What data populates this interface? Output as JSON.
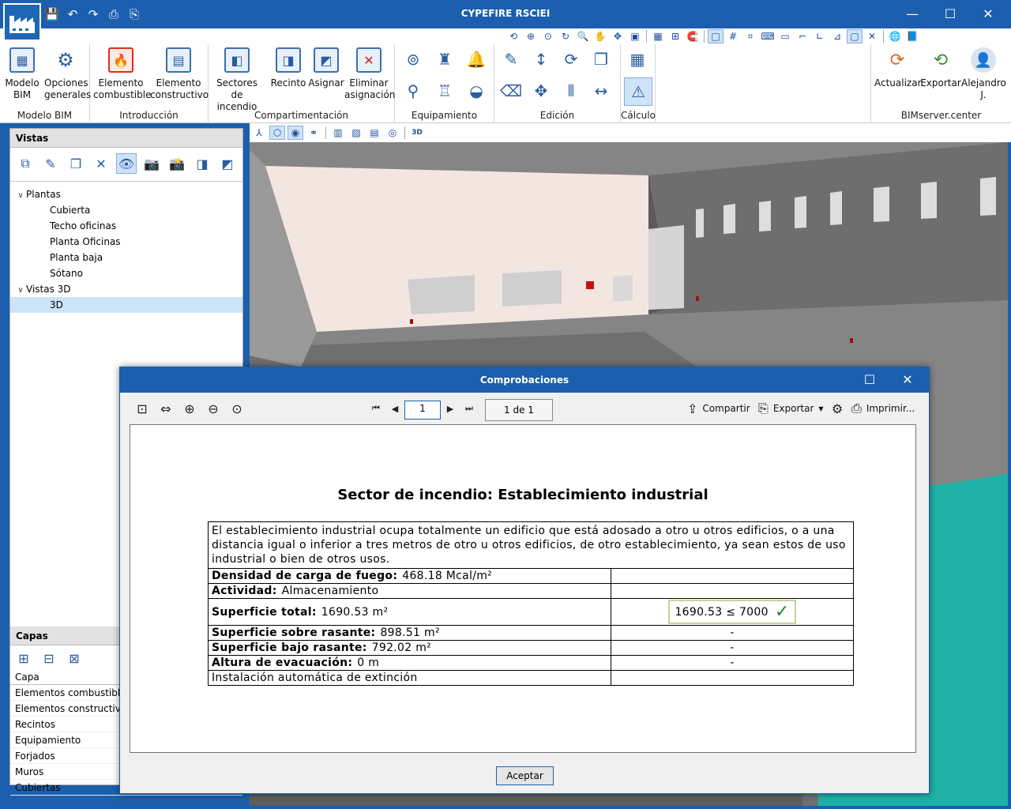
{
  "app": {
    "title": "CYPEFIRE RSCIEI"
  },
  "ribbon": {
    "groups": [
      {
        "label": "Modelo BIM",
        "buttons": [
          "Modelo BIM",
          "Opciones generales"
        ]
      },
      {
        "label": "Introducción",
        "buttons": [
          "Elemento combustible",
          "Elemento constructivo"
        ]
      },
      {
        "label": "Compartimentación",
        "buttons": [
          "Sectores de incendio",
          "Recinto",
          "Asignar",
          "Eliminar asignación"
        ]
      },
      {
        "label": "Equipamiento"
      },
      {
        "label": "Edición"
      },
      {
        "label": "Cálculo"
      },
      {
        "label": "BIMserver.center",
        "buttons": [
          "Actualizar",
          "Exportar",
          "Alejandro J."
        ]
      }
    ]
  },
  "vistas": {
    "title": "Vistas",
    "tree": [
      {
        "label": "Plantas",
        "children": [
          "Cubierta",
          "Techo oficinas",
          "Planta Oficinas",
          "Planta baja",
          "Sótano"
        ]
      },
      {
        "label": "Vistas 3D",
        "children": [
          "3D"
        ]
      }
    ]
  },
  "capas": {
    "title": "Capas",
    "column": "Capa",
    "rows": [
      "Elementos combustibles",
      "Elementos constructivos",
      "Recintos",
      "Equipamiento",
      "Forjados",
      "Muros",
      "Cubiertas"
    ]
  },
  "viewport": {
    "label_3d": "3D"
  },
  "dialog": {
    "title": "Comprobaciones",
    "page_value": "1",
    "page_count": "1 de 1",
    "share": "Compartir",
    "export": "Exportar",
    "print": "Imprimir...",
    "accept": "Aceptar",
    "report": {
      "title": "Sector de incendio: Establecimiento industrial",
      "intro": "El establecimiento industrial ocupa totalmente un edificio que está adosado a otro u otros edificios, o a una distancia igual o inferior a tres metros de otro u otros edificios, de otro establecimiento, ya sean estos de uso industrial o bien de otros usos.",
      "rows": [
        {
          "label": "Densidad de carga de fuego:",
          "value": "468.18 Mcal/m²",
          "check": ""
        },
        {
          "label": "Actividad:",
          "value": "Almacenamiento",
          "check": ""
        },
        {
          "label": "Superficie total:",
          "value": "1690.53 m²",
          "check": "1690.53 ≤ 7000",
          "ok": true
        },
        {
          "label": "Superficie sobre rasante:",
          "value": "898.51 m²",
          "check": "-"
        },
        {
          "label": "Superficie bajo rasante:",
          "value": "792.02 m²",
          "check": "-"
        },
        {
          "label": "Altura de evacuación:",
          "value": "0 m",
          "check": "-"
        },
        {
          "label": "",
          "value": "Instalación automática de extinción",
          "check": ""
        }
      ]
    }
  },
  "colors": {
    "chrome": "#1b5fae",
    "ok_check": "#1e8a2e",
    "wall": "#f3e6e1"
  }
}
